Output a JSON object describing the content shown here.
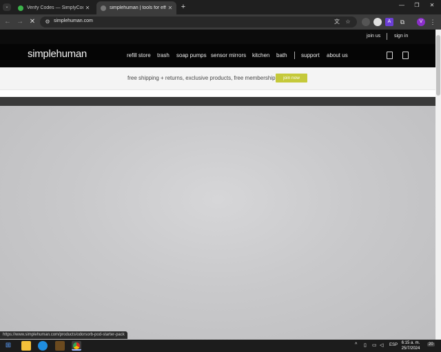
{
  "browser": {
    "tabs": [
      {
        "title": "Verify Codes — SimplyCodes",
        "active": false,
        "favicon_color": "#3cb44b"
      },
      {
        "title": "simplehuman | tools for efficient",
        "active": true,
        "favicon_color": "#888888"
      }
    ],
    "url": "simplehuman.com",
    "new_tab_glyph": "+",
    "extensions": [
      {
        "label": "",
        "color": "#e0e0e0"
      },
      {
        "label": "A",
        "color": "#6c3fd6"
      },
      {
        "label": "V",
        "color": "#8b2fc9"
      }
    ]
  },
  "site": {
    "utility_links": {
      "join": "join us",
      "signin": "sign in"
    },
    "logo": "simplehuman",
    "nav": [
      "refill store",
      "trash",
      "soap pumps",
      "sensor mirrors",
      "kitchen",
      "bath",
      "support",
      "about us"
    ],
    "promo_text": "free shipping + returns, exclusive products, free membership",
    "promo_button": "join now",
    "accent": "#c5c93a"
  },
  "status_url": "https://www.simplehuman.com/products/odorsorb-pod-starter-pack",
  "taskbar": {
    "language": "ESP",
    "time": "6:15 a. m.",
    "date": "25/7/2024",
    "notifications": "20"
  }
}
